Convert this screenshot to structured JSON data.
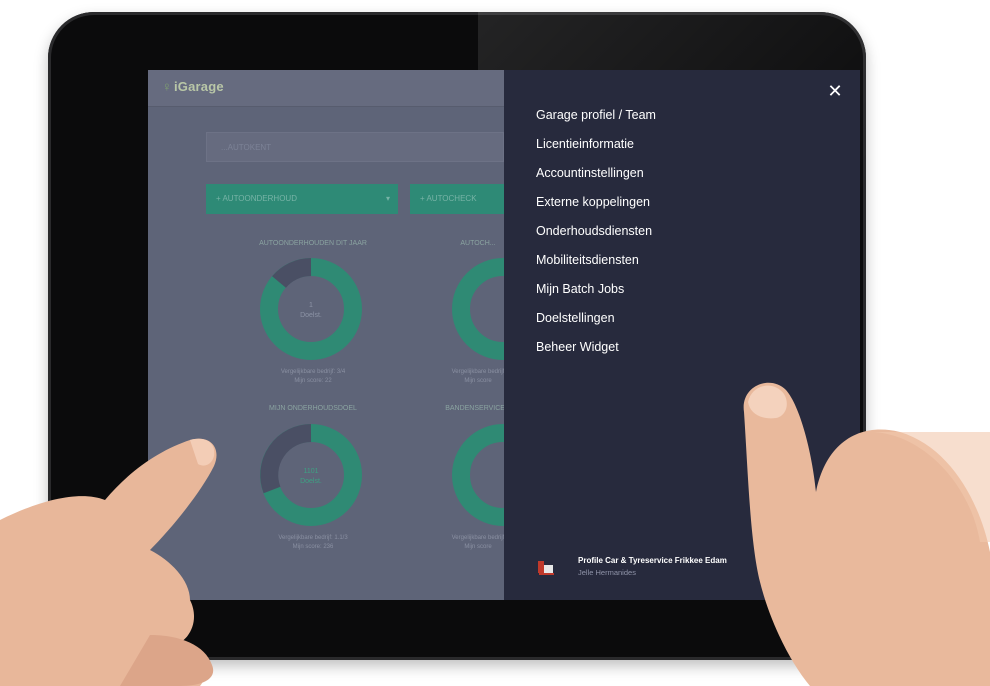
{
  "app": {
    "logo": "iGarage",
    "search_placeholder": "...AUTOKENT",
    "buttons": [
      {
        "label": "+ AUTOONDERHOUD"
      },
      {
        "label": "+ AUTOCHECK"
      }
    ],
    "cards": [
      {
        "title": "AUTOONDERHOUDEN DIT JAAR",
        "center": "1\nDoelstelling",
        "foot": "Vergelijkbare bedrijf: 3/4\nMijn score: 22"
      },
      {
        "title": "AUTOCH...",
        "center": "",
        "foot": "Vergelijkbare bedrijf\nMijn score"
      },
      {
        "title": "MIJN ONDERHOUDSDOEL",
        "center": "1101\nDoelstelling",
        "foot": "Vergelijkbare bedrijf: 1.1/3\nMijn score: 236"
      },
      {
        "title": "BANDENSERVICE...",
        "center": "",
        "foot": "Vergelijkbare bedrijf\nMijn score"
      }
    ]
  },
  "menu": {
    "close_icon": "close-icon",
    "items": [
      "Garage profiel / Team",
      "Licentieinformatie",
      "Accountinstellingen",
      "Externe koppelingen",
      "Onderhoudsdiensten",
      "Mobiliteitsdiensten",
      "Mijn Batch Jobs",
      "Doelstellingen",
      "Beheer Widget"
    ],
    "footer": {
      "garage_name": "Profile Car & Tyreservice Frikkee Edam",
      "user_name": "Jelle Hermanides",
      "download_icon": "download-icon",
      "logout_icon": "logout-icon"
    }
  },
  "colors": {
    "menu_bg": "#272a3d",
    "accent": "#2ea58a",
    "dimmed_app": "#5e6478"
  }
}
